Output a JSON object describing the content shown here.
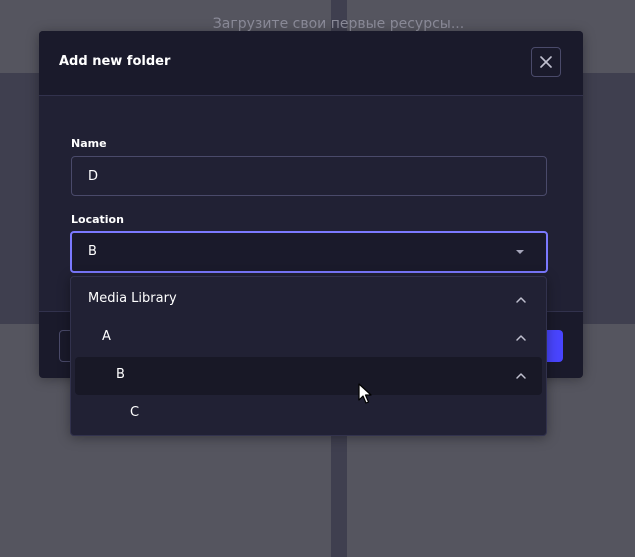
{
  "background": {
    "hint_text": "Загрузите свои первые ресурсы..."
  },
  "modal": {
    "title": "Add new folder",
    "close_icon": "close-icon",
    "name_field": {
      "label": "Name",
      "value": "D"
    },
    "location_field": {
      "label": "Location",
      "selected_value": "B"
    }
  },
  "dropdown": {
    "items": [
      {
        "label": "Media Library",
        "level": 0,
        "expanded": true,
        "hovered": false
      },
      {
        "label": "A",
        "level": 1,
        "expanded": true,
        "hovered": false
      },
      {
        "label": "B",
        "level": 2,
        "expanded": true,
        "hovered": true
      },
      {
        "label": "C",
        "level": 3,
        "expanded": false,
        "hovered": false
      }
    ]
  },
  "colors": {
    "accent": "#7b79ff",
    "primary_button": "#4945ff",
    "modal_bg": "#212134",
    "header_bg": "#1a1a2b"
  }
}
